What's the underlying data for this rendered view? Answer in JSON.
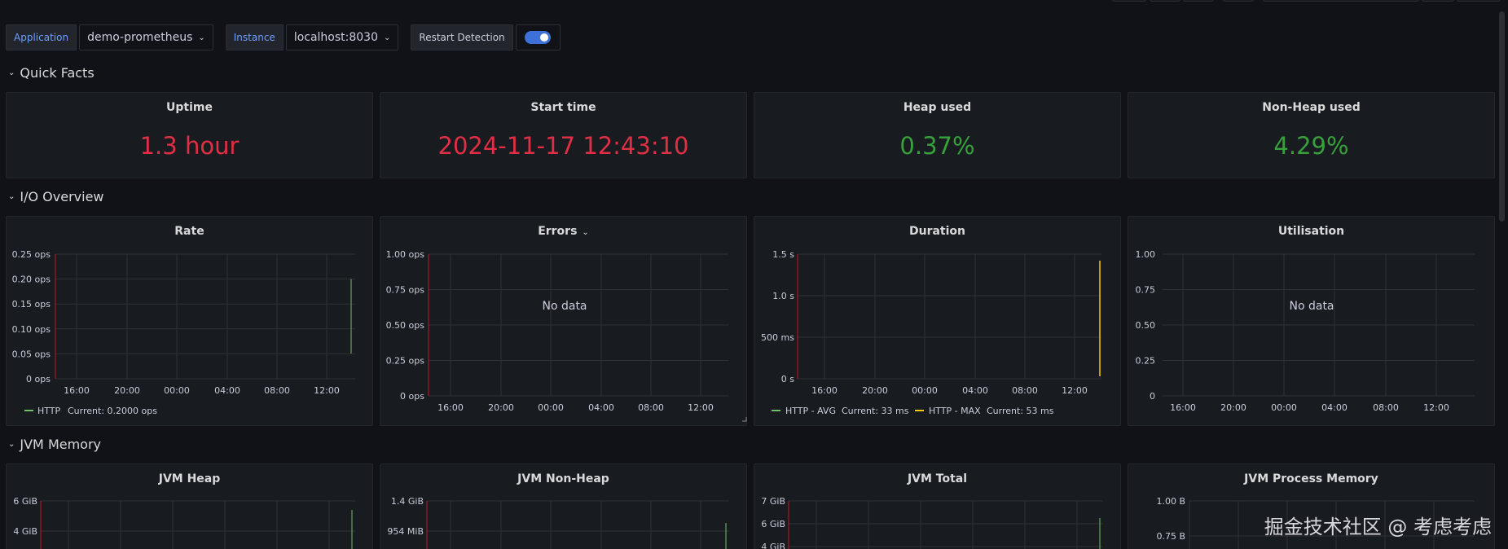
{
  "variables": {
    "application": {
      "label": "Application",
      "value": "demo-prometheus"
    },
    "instance": {
      "label": "Instance",
      "value": "localhost:8030"
    },
    "restart_label": "Restart Detection",
    "restart_enabled": true
  },
  "rows": {
    "quick_facts": "Quick Facts",
    "io_overview": "I/O Overview",
    "jvm_memory": "JVM Memory"
  },
  "stats": [
    {
      "title": "Uptime",
      "value": "1.3 hour",
      "color": "#e02f44"
    },
    {
      "title": "Start time",
      "value": "2024-11-17 12:43:10",
      "color": "#e02f44"
    },
    {
      "title": "Heap used",
      "value": "0.37%",
      "color": "#37a03b"
    },
    {
      "title": "Non-Heap used",
      "value": "4.29%",
      "color": "#37a03b"
    }
  ],
  "io_charts": [
    {
      "title": "Rate",
      "y_ticks": [
        "0.25 ops",
        "0.20 ops",
        "0.15 ops",
        "0.10 ops",
        "0.05 ops",
        "0 ops"
      ],
      "x_ticks": [
        "16:00",
        "20:00",
        "00:00",
        "04:00",
        "08:00",
        "12:00"
      ],
      "legend": [
        {
          "name": "HTTP",
          "current": "Current: 0.2000 ops",
          "color": "#73bf69"
        }
      ]
    },
    {
      "title": "Errors",
      "y_ticks": [
        "1.00 ops",
        "0.75 ops",
        "0.50 ops",
        "0.25 ops",
        "0 ops"
      ],
      "x_ticks": [
        "16:00",
        "20:00",
        "00:00",
        "04:00",
        "08:00",
        "12:00"
      ],
      "no_data": "No data",
      "legend": []
    },
    {
      "title": "Duration",
      "y_ticks": [
        "1.5 s",
        "1.0 s",
        "500 ms",
        "0 s"
      ],
      "x_ticks": [
        "16:00",
        "20:00",
        "00:00",
        "04:00",
        "08:00",
        "12:00"
      ],
      "legend": [
        {
          "name": "HTTP - AVG",
          "current": "Current: 33 ms",
          "color": "#73bf69"
        },
        {
          "name": "HTTP - MAX",
          "current": "Current: 53 ms",
          "color": "#f2cc0c"
        }
      ]
    },
    {
      "title": "Utilisation",
      "y_ticks": [
        "1.00",
        "0.75",
        "0.50",
        "0.25",
        "0"
      ],
      "x_ticks": [
        "16:00",
        "20:00",
        "00:00",
        "04:00",
        "08:00",
        "12:00"
      ],
      "no_data": "No data",
      "legend": []
    }
  ],
  "jvm_charts": [
    {
      "title": "JVM Heap",
      "y_ticks": [
        "6 GiB",
        "4 GiB"
      ]
    },
    {
      "title": "JVM Non-Heap",
      "y_ticks": [
        "1.4 GiB",
        "954 MiB"
      ]
    },
    {
      "title": "JVM Total",
      "y_ticks": [
        "7 GiB",
        "6 GiB",
        "4 GiB"
      ]
    },
    {
      "title": "JVM Process Memory",
      "y_ticks": [
        "1.00 B",
        "0.75 B"
      ]
    }
  ],
  "watermark": "掘金技术社区 @ 考虑考虑"
}
